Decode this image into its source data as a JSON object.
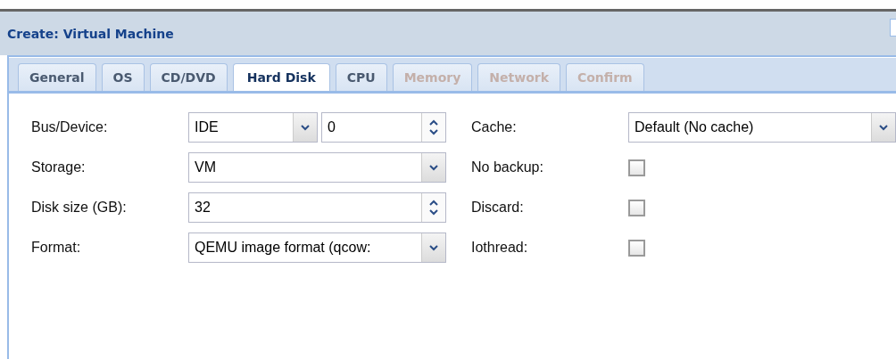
{
  "window": {
    "title": "Create: Virtual Machine"
  },
  "tabs": [
    {
      "label": "General",
      "selected": false,
      "disabled": false
    },
    {
      "label": "OS",
      "selected": false,
      "disabled": false
    },
    {
      "label": "CD/DVD",
      "selected": false,
      "disabled": false
    },
    {
      "label": "Hard Disk",
      "selected": true,
      "disabled": false
    },
    {
      "label": "CPU",
      "selected": false,
      "disabled": false
    },
    {
      "label": "Memory",
      "selected": false,
      "disabled": true
    },
    {
      "label": "Network",
      "selected": false,
      "disabled": true
    },
    {
      "label": "Confirm",
      "selected": false,
      "disabled": true
    }
  ],
  "left_fields": [
    {
      "label": "Bus/Device:",
      "kind": "select_spinner",
      "value": "IDE",
      "value_2": "0"
    },
    {
      "label": "Storage:",
      "kind": "select",
      "value": "VM"
    },
    {
      "label": "Disk size (GB):",
      "kind": "spinner",
      "value": "32"
    },
    {
      "label": "Format:",
      "kind": "select",
      "value": "QEMU image format (qcow:"
    }
  ],
  "right_fields": [
    {
      "label": "Cache:",
      "kind": "select",
      "value": "Default (No cache)"
    },
    {
      "label": "No backup:",
      "kind": "checkbox",
      "checked": false
    },
    {
      "label": "Discard:",
      "kind": "checkbox",
      "checked": false
    },
    {
      "label": "Iothread:",
      "kind": "checkbox",
      "checked": false
    }
  ]
}
